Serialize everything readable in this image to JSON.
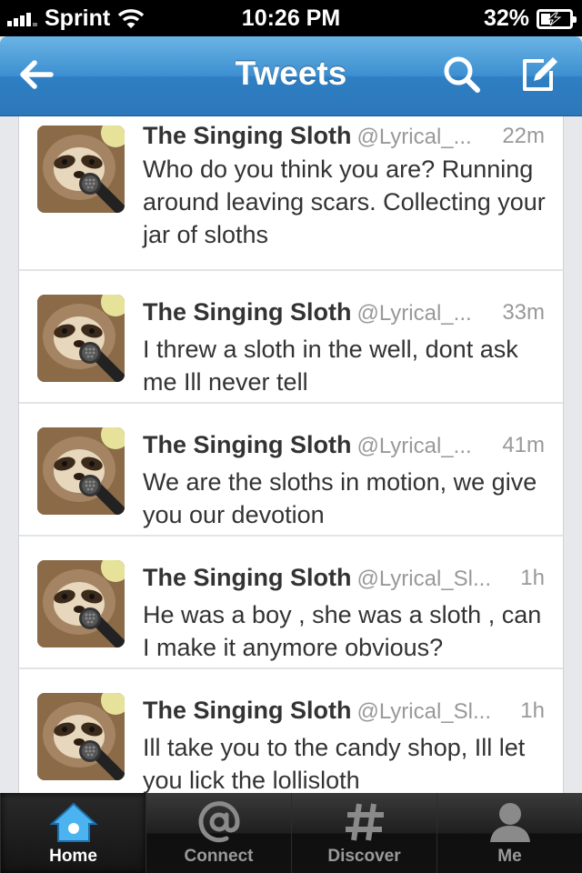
{
  "status_bar": {
    "carrier": "Sprint",
    "time": "10:26 PM",
    "battery": "32%",
    "battery_level": 0.32,
    "signal_bars": 4
  },
  "nav": {
    "title": "Tweets",
    "accent_color": "#3d8fd0"
  },
  "tweets": [
    {
      "author": "The Singing Sloth",
      "handle": "@Lyrical_...",
      "time": "22m",
      "text": "Who do you think you are? Running around leaving scars. Collecting your jar of sloths"
    },
    {
      "author": "The Singing Sloth",
      "handle": "@Lyrical_...",
      "time": "33m",
      "text": "I threw a sloth in the well, dont ask me Ill never tell"
    },
    {
      "author": "The Singing Sloth",
      "handle": "@Lyrical_...",
      "time": "41m",
      "text": "We are the sloths in motion, we give you our devotion"
    },
    {
      "author": "The Singing Sloth",
      "handle": "@Lyrical_Sl...",
      "time": "1h",
      "text": "He was a boy , she was a sloth , can I make it anymore obvious?"
    },
    {
      "author": "The Singing Sloth",
      "handle": "@Lyrical_Sl...",
      "time": "1h",
      "text": "Ill take you to the candy shop, Ill let you lick the lollisloth"
    }
  ],
  "tabs": [
    {
      "label": "Home",
      "icon": "home-icon",
      "active": true
    },
    {
      "label": "Connect",
      "icon": "at-icon",
      "active": false
    },
    {
      "label": "Discover",
      "icon": "hash-icon",
      "active": false
    },
    {
      "label": "Me",
      "icon": "person-icon",
      "active": false
    }
  ]
}
